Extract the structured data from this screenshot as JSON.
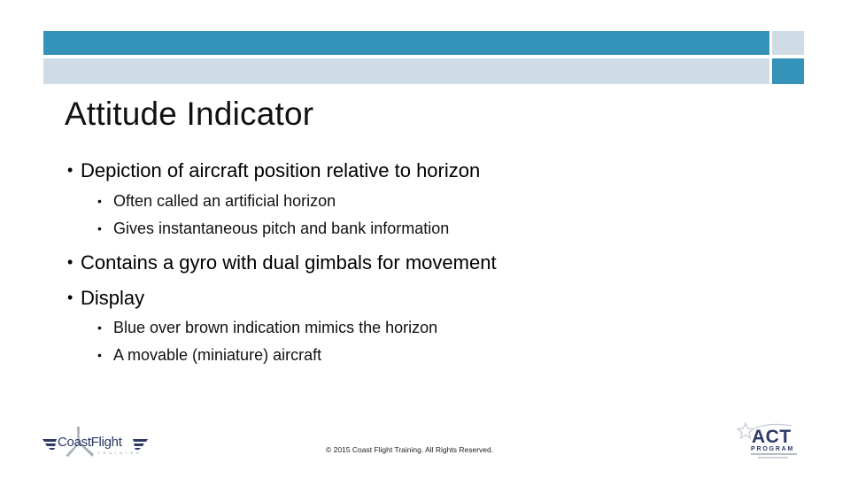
{
  "slide": {
    "title": "Attitude Indicator",
    "bullets": [
      {
        "level": 1,
        "text": "Depiction of aircraft position relative to horizon"
      },
      {
        "level": 2,
        "text": "Often called an artificial horizon"
      },
      {
        "level": 2,
        "text": "Gives instantaneous pitch and bank information"
      },
      {
        "level": 1,
        "text": "Contains a gyro with dual gimbals for movement"
      },
      {
        "level": 1,
        "text": "Display"
      },
      {
        "level": 2,
        "text": "Blue over brown indication mimics the horizon"
      },
      {
        "level": 2,
        "text": "A movable (miniature) aircraft"
      }
    ],
    "bullet_glyph": "•"
  },
  "footer": {
    "copyright": "© 2015 Coast Flight Training. All Rights Reserved.",
    "logo_left": {
      "name": "CoastFlight",
      "wordmark": "CoastFlight",
      "subtitle": "TRAINING"
    },
    "logo_right": {
      "name": "ACT Program",
      "wordmark": "ACT",
      "subtitle": "PROGRAM"
    }
  },
  "theme": {
    "accent_blue": "#3592B8",
    "accent_light": "#CFDCE6",
    "logo_navy": "#2B3A66"
  }
}
